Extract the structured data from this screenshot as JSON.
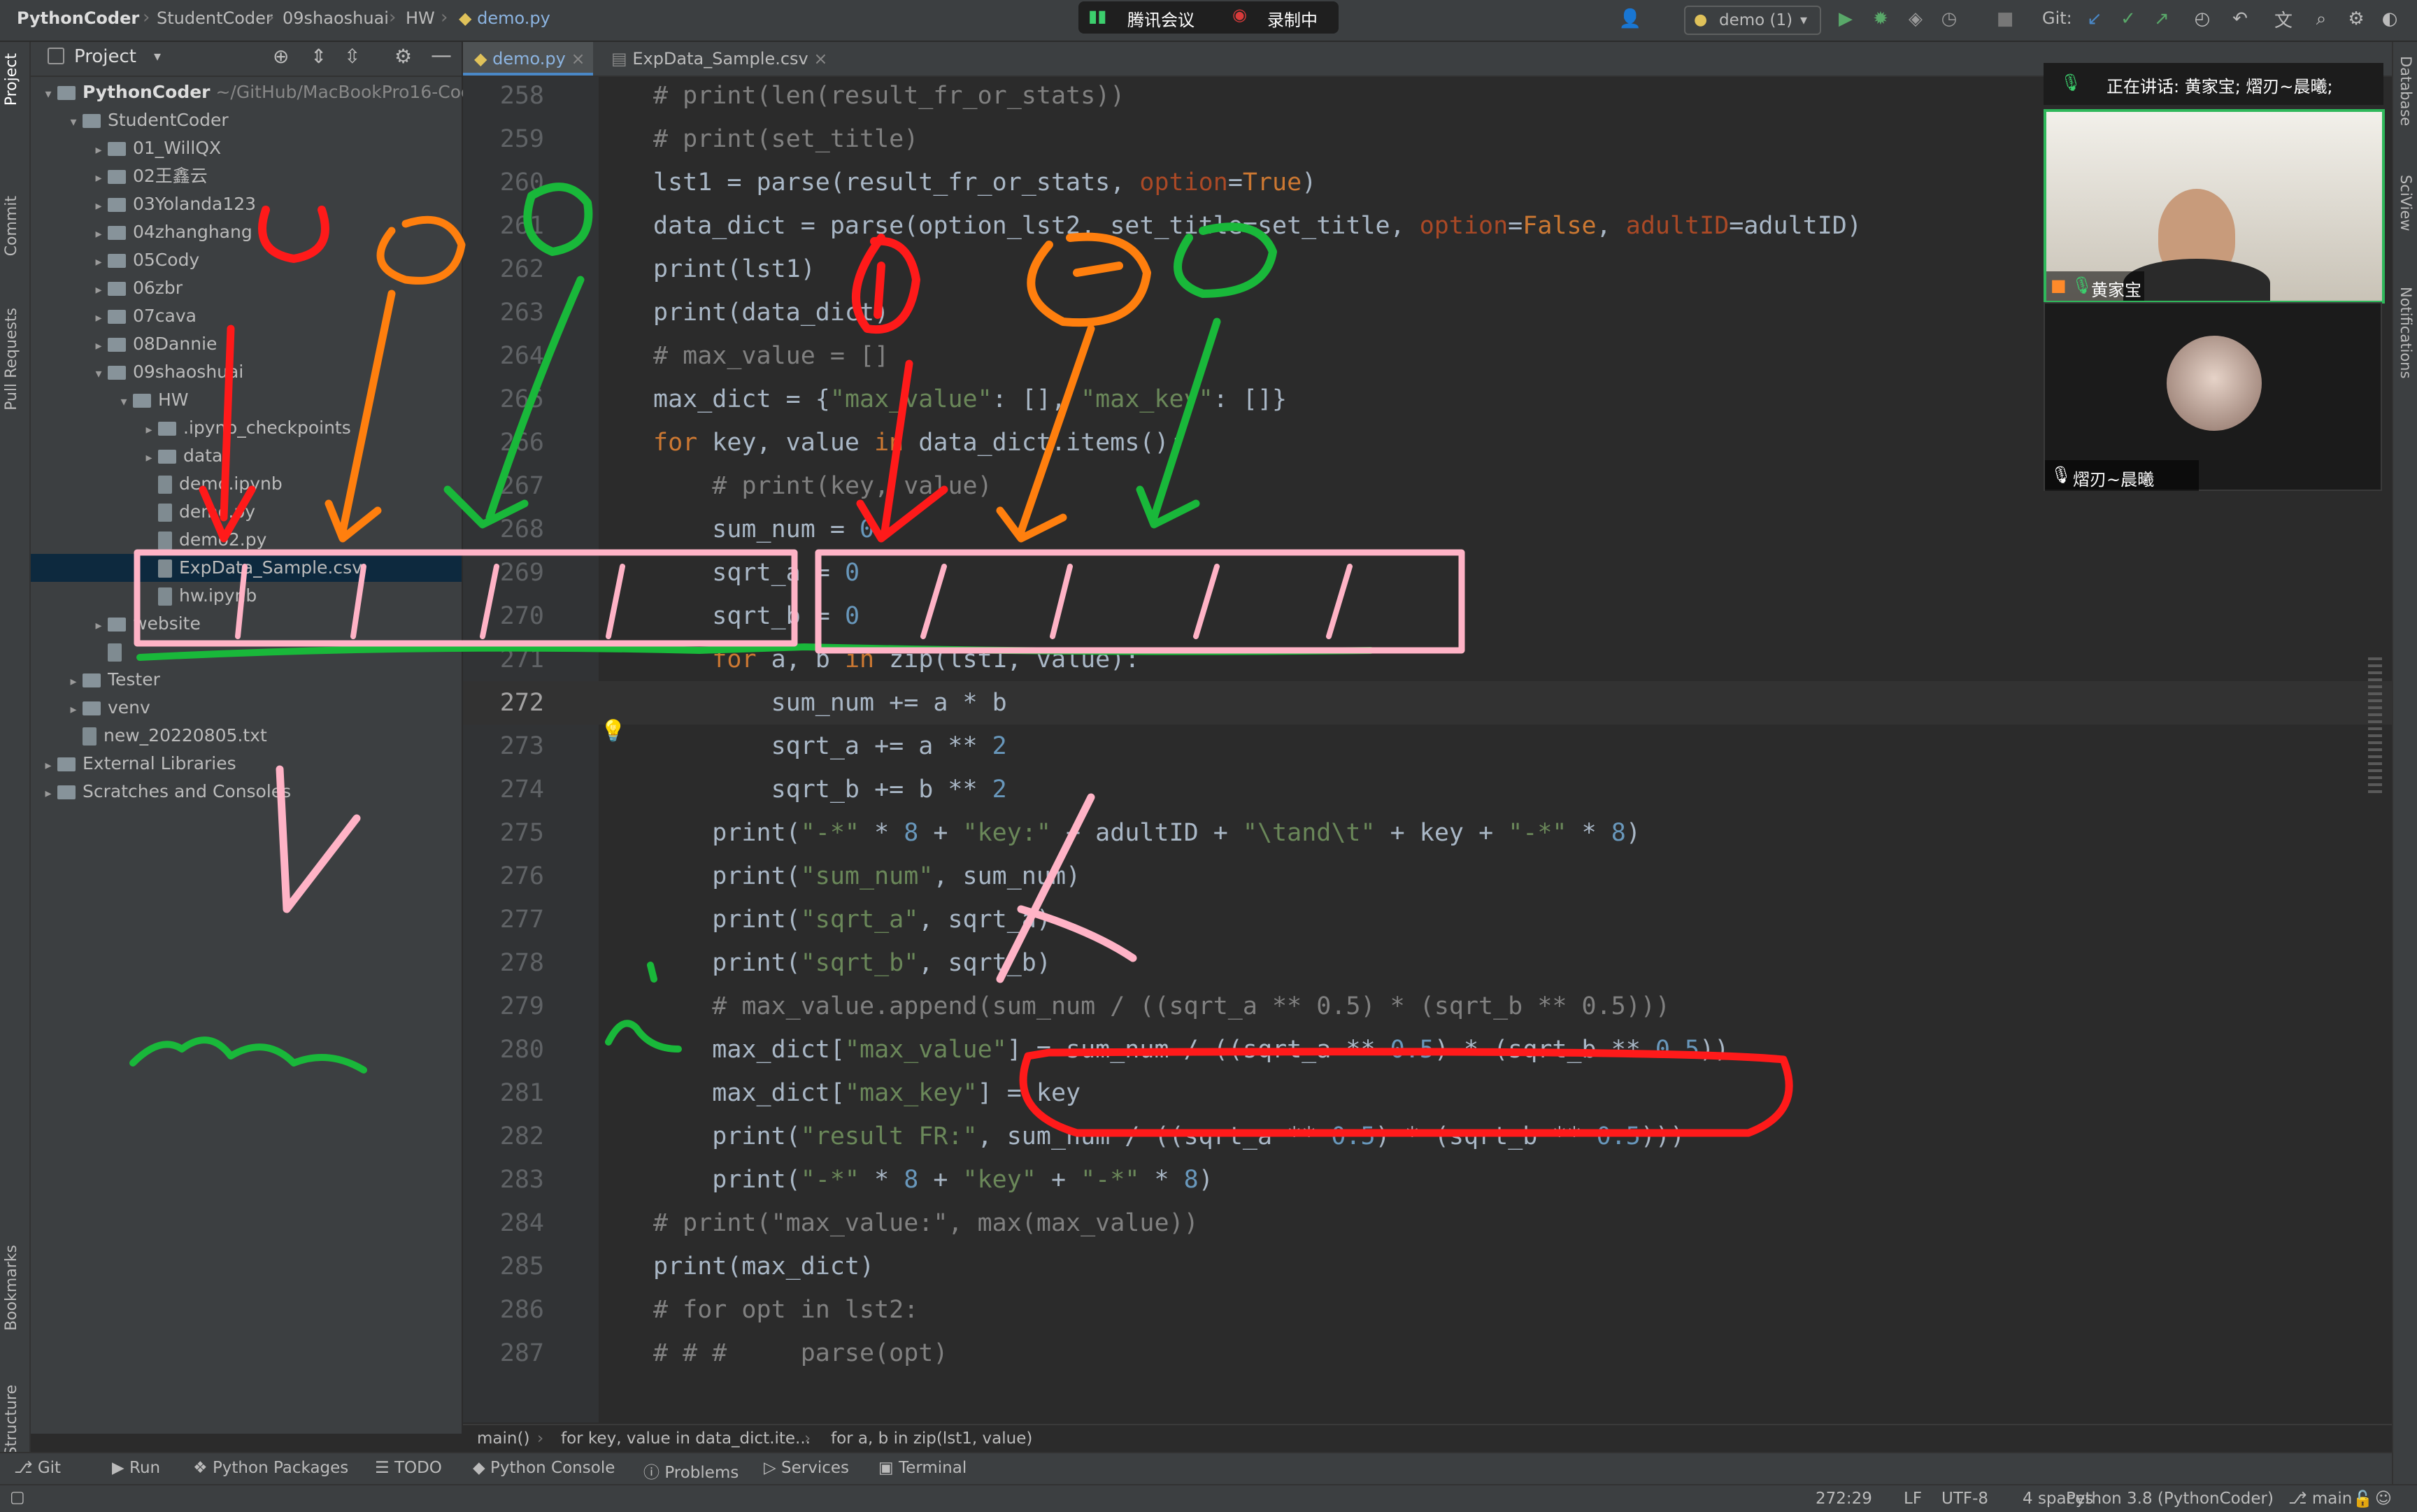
{
  "titlebar": {
    "project": "PythonCoder",
    "path": [
      "StudentCoder",
      "09shaoshuai",
      "HW"
    ],
    "file": "demo.py"
  },
  "meeting": {
    "app": "腾讯会议",
    "recording": "录制中"
  },
  "run_config": "demo (1)",
  "git_label": "Git:",
  "project_panel": {
    "title": "Project",
    "root": "PythonCoder",
    "root_path": "~/GitHub/MacBookPro16-Cod",
    "items": [
      {
        "label": "StudentCoder",
        "type": "folder",
        "level": 1,
        "open": true
      },
      {
        "label": "01_WillQX",
        "type": "folder",
        "level": 2
      },
      {
        "label": "02王鑫云",
        "type": "folder",
        "level": 2
      },
      {
        "label": "03Yolanda123",
        "type": "folder",
        "level": 2
      },
      {
        "label": "04zhanghang",
        "type": "folder",
        "level": 2
      },
      {
        "label": "05Cody",
        "type": "folder",
        "level": 2
      },
      {
        "label": "06zbr",
        "type": "folder",
        "level": 2
      },
      {
        "label": "07cava",
        "type": "folder",
        "level": 2
      },
      {
        "label": "08Dannie",
        "type": "folder",
        "level": 2
      },
      {
        "label": "09shaoshuai",
        "type": "folder",
        "level": 2,
        "open": true
      },
      {
        "label": "HW",
        "type": "folder",
        "level": 3,
        "open": true
      },
      {
        "label": ".ipynb_checkpoints",
        "type": "folder",
        "level": 4
      },
      {
        "label": "data",
        "type": "folder",
        "level": 4
      },
      {
        "label": "demo.ipynb",
        "type": "file",
        "level": 4
      },
      {
        "label": "demo.py",
        "type": "file",
        "level": 4
      },
      {
        "label": "demo2.py",
        "type": "file",
        "level": 4
      },
      {
        "label": "ExpData_Sample.csv",
        "type": "file",
        "level": 4,
        "selected": true
      },
      {
        "label": "hw.ipynb",
        "type": "file",
        "level": 4
      },
      {
        "label": "website",
        "type": "folder",
        "level": 2
      },
      {
        "label": "",
        "type": "file",
        "level": 2
      },
      {
        "label": "Tester",
        "type": "folder",
        "level": 1
      },
      {
        "label": "venv",
        "type": "folder",
        "level": 1
      },
      {
        "label": "new_20220805.txt",
        "type": "file",
        "level": 1
      },
      {
        "label": "External Libraries",
        "type": "lib",
        "level": 0
      },
      {
        "label": "Scratches and Consoles",
        "type": "lib",
        "level": 0
      }
    ]
  },
  "tabs": [
    {
      "label": "demo.py",
      "active": true
    },
    {
      "label": "ExpData_Sample.csv",
      "active": false
    }
  ],
  "editor": {
    "lines": [
      {
        "n": "258",
        "html": "<span class=\"cmt\"># print(len(result_fr_or_stats))</span>"
      },
      {
        "n": "259",
        "html": "<span class=\"cmt\"># print(set_title)</span>"
      },
      {
        "n": "260",
        "html": "lst1 = parse(result_fr_or_stats, <span class=\"param\">option</span>=<span class=\"kw\">True</span>)"
      },
      {
        "n": "261",
        "html": "data_dict = parse(option_lst2, set_title=set_title, <span class=\"param\">option</span>=<span class=\"kw\">False</span>, <span class=\"param\">adultID</span>=adultID)"
      },
      {
        "n": "262",
        "html": "print(lst1)"
      },
      {
        "n": "263",
        "html": "print(data_dict)"
      },
      {
        "n": "264",
        "html": "<span class=\"cmt\"># max_value = []</span>"
      },
      {
        "n": "265",
        "html": "max_dict = {<span class=\"str\">\"max_value\"</span>: [], <span class=\"str\">\"max_key\"</span>: []}"
      },
      {
        "n": "266",
        "html": "<span class=\"kw\">for</span> key, value <span class=\"kw\">in</span> data_dict.items():"
      },
      {
        "n": "267",
        "html": "    <span class=\"cmt\"># print(key, value)</span>"
      },
      {
        "n": "268",
        "html": "    sum_num = <span class=\"num\">0</span>"
      },
      {
        "n": "269",
        "html": "    sqrt_a = <span class=\"num\">0</span>"
      },
      {
        "n": "270",
        "html": "    sqrt_b = <span class=\"num\">0</span>"
      },
      {
        "n": "271",
        "html": "    <span class=\"kw\">for</span> a, b <span class=\"kw\">in</span> zip(lst1, value):"
      },
      {
        "n": "272",
        "html": "        sum_num += a * b",
        "current": true
      },
      {
        "n": "273",
        "html": "        sqrt_a += a ** <span class=\"num\">2</span>"
      },
      {
        "n": "274",
        "html": "        sqrt_b += b ** <span class=\"num\">2</span>"
      },
      {
        "n": "275",
        "html": "    print(<span class=\"str\">\"-*\"</span> * <span class=\"num\">8</span> + <span class=\"str\">\"key:\"</span> + adultID + <span class=\"str\">\"\\tand\\t\"</span> + key + <span class=\"str\">\"-*\"</span> * <span class=\"num\">8</span>)"
      },
      {
        "n": "276",
        "html": "    print(<span class=\"str\">\"sum_num\"</span>, sum_num)"
      },
      {
        "n": "277",
        "html": "    print(<span class=\"str\">\"sqrt_a\"</span>, sqrt_a)"
      },
      {
        "n": "278",
        "html": "    print(<span class=\"str\">\"sqrt_b\"</span>, sqrt_b)"
      },
      {
        "n": "279",
        "html": "    <span class=\"cmt\"># max_value.append(sum_num / ((sqrt_a ** 0.5) * (sqrt_b ** 0.5)))</span>"
      },
      {
        "n": "280",
        "html": "    max_dict[<span class=\"str\">\"max_value\"</span>] = sum_num / ((sqrt_a ** <span class=\"num\">0.5</span>) * (sqrt_b ** <span class=\"num\">0.5</span>))"
      },
      {
        "n": "281",
        "html": "    max_dict[<span class=\"str\">\"max_key\"</span>] = key"
      },
      {
        "n": "282",
        "html": "    print(<span class=\"str\">\"result FR:\"</span>, sum_num / ((sqrt_a ** <span class=\"num\">0.5</span>) * (sqrt_b ** <span class=\"num\">0.5</span>)))"
      },
      {
        "n": "283",
        "html": "    print(<span class=\"str\">\"-*\"</span> * <span class=\"num\">8</span> + <span class=\"str\">\"key\"</span> + <span class=\"str\">\"-*\"</span> * <span class=\"num\">8</span>)"
      },
      {
        "n": "284",
        "html": "<span class=\"cmt\"># print(\"max_value:\", max(max_value))</span>"
      },
      {
        "n": "285",
        "html": "print(max_dict)"
      },
      {
        "n": "286",
        "html": "<span class=\"cmt\"># for opt in lst2:</span>"
      },
      {
        "n": "287",
        "html": "<span class=\"cmt\"># # #     parse(opt)</span>"
      }
    ]
  },
  "code_breadcrumb": [
    "main()",
    "for key, value in data_dict.ite...",
    "for a, b in zip(lst1, value)"
  ],
  "bottom_tools": [
    "Git",
    "Run",
    "Python Packages",
    "TODO",
    "Python Console",
    "Problems",
    "Services",
    "Terminal"
  ],
  "status": {
    "position": "272:29",
    "line_sep": "LF",
    "encoding": "UTF-8",
    "indent": "4 spaces",
    "interpreter": "Python 3.8 (PythonCoder)",
    "branch": "main"
  },
  "left_tools": [
    "Project",
    "Commit",
    "Pull Requests",
    "Bookmarks",
    "Structure"
  ],
  "right_tools": [
    "Database",
    "SciView",
    "Notifications"
  ],
  "video": {
    "speaking": "正在讲话: 黄家宝; 熠刃~晨曦;",
    "participant1": "黄家宝",
    "participant2": "熠刃~晨曦"
  },
  "colors": {
    "accent": "#4a88c7",
    "annotation_red": "#ff1a1a",
    "annotation_orange": "#ff7f0e",
    "annotation_green": "#19b83a",
    "annotation_pink": "#ffb3c6"
  }
}
